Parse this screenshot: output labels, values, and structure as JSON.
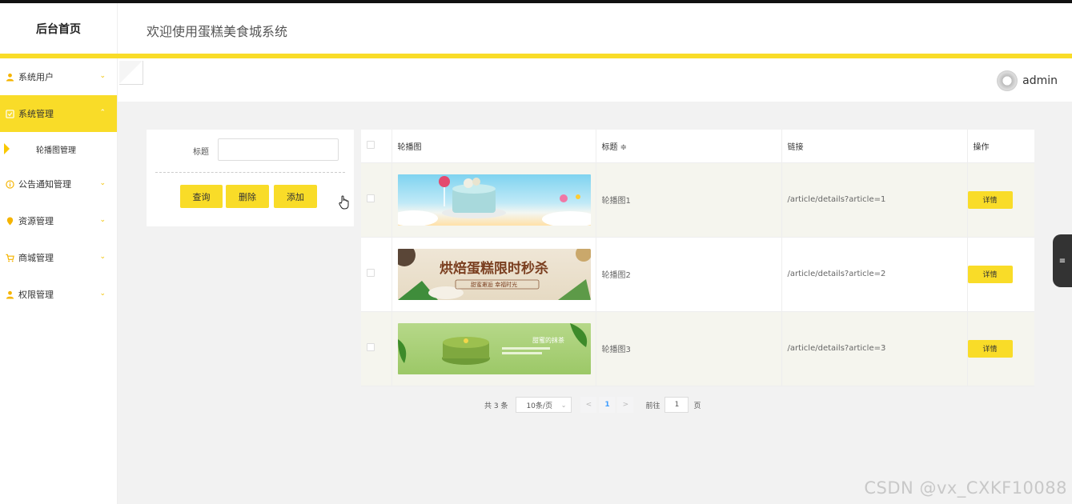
{
  "header": {
    "logo": "后台首页",
    "system_title": "欢迎使用蛋糕美食城系统"
  },
  "user": {
    "name": "admin"
  },
  "sidebar": {
    "items": [
      {
        "label": "系统用户",
        "icon": "user-icon"
      },
      {
        "label": "系统管理",
        "icon": "settings-icon",
        "active": true,
        "children": [
          {
            "label": "轮播图管理"
          }
        ]
      },
      {
        "label": "公告通知管理",
        "icon": "info-icon"
      },
      {
        "label": "资源管理",
        "icon": "location-icon"
      },
      {
        "label": "商城管理",
        "icon": "cart-icon"
      },
      {
        "label": "权限管理",
        "icon": "user-icon"
      }
    ]
  },
  "search": {
    "title_label": "标题",
    "title_value": "",
    "query_label": "查询",
    "delete_label": "删除",
    "add_label": "添加"
  },
  "table": {
    "headers": [
      "轮播图",
      "标题 ≑",
      "链接",
      "操作"
    ],
    "rows": [
      {
        "title": "轮播图1",
        "link": "/article/details?article=1",
        "action": "详情",
        "banner_text": ""
      },
      {
        "title": "轮播图2",
        "link": "/article/details?article=2",
        "action": "详情",
        "banner_text": "烘焙蛋糕限时秒杀",
        "banner_sub": "甜蜜邂逅 幸福时光"
      },
      {
        "title": "轮播图3",
        "link": "/article/details?article=3",
        "action": "详情",
        "banner_text": "甜蜜的抹茶"
      }
    ]
  },
  "pagination": {
    "total": "共 3 条",
    "page_size": "10条/页",
    "prev": "<",
    "current": "1",
    "next": ">",
    "goto_label": "前往",
    "goto_value": "1",
    "page_suffix": "页"
  },
  "watermark": "CSDN @vx_CXKF10088",
  "colors": {
    "accent": "#f9dc28",
    "sidebar_active": "#f9dc28"
  }
}
